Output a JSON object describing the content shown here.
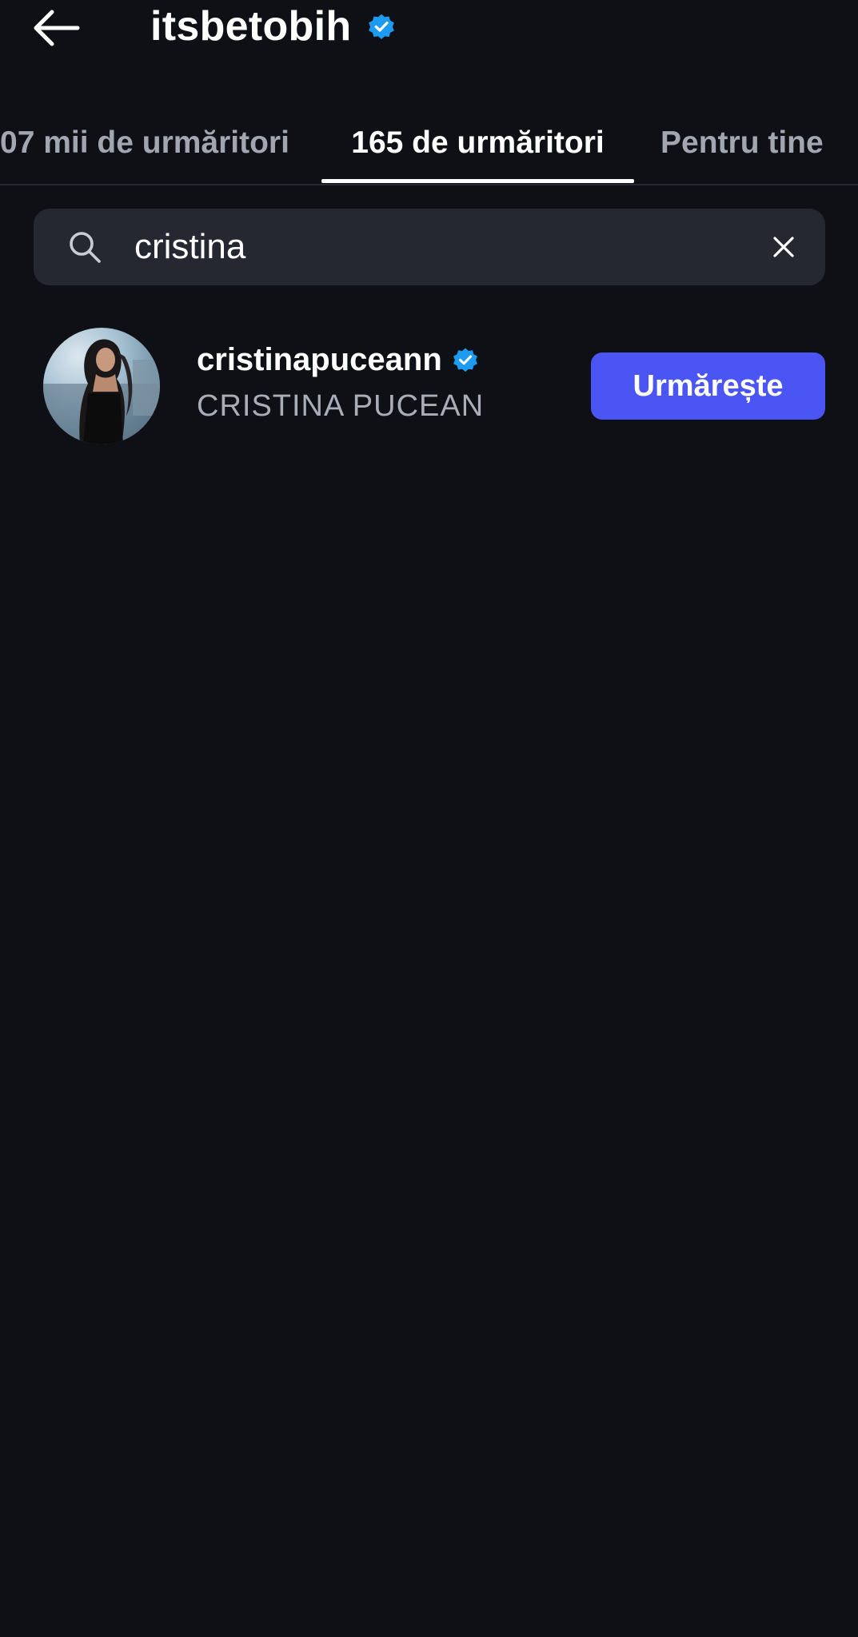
{
  "header": {
    "title": "itsbetobih",
    "verified": true,
    "back_icon": "arrow-left-icon",
    "badge_color": "#1d9bf0"
  },
  "tabs": [
    {
      "label": "07 mii de urmăritori",
      "active": false
    },
    {
      "label": "165 de urmăritori",
      "active": true
    },
    {
      "label": "Pentru tine",
      "active": false
    }
  ],
  "search": {
    "value": "cristina",
    "icon": "search-icon",
    "clear_icon": "close-icon"
  },
  "results": [
    {
      "username": "cristinapuceann",
      "fullname": "CRISTINA PUCEAN",
      "verified": true,
      "action_label": "Urmărește"
    }
  ],
  "colors": {
    "background": "#0e1016",
    "search_bg": "#252830",
    "accent": "#4a55f3",
    "muted_text": "#a2a6b0"
  }
}
